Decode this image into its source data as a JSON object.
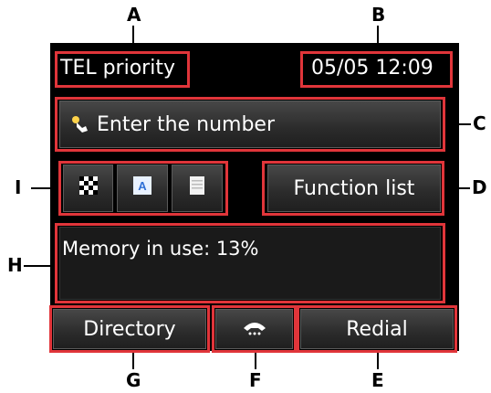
{
  "callouts": {
    "a": "A",
    "b": "B",
    "c": "C",
    "d": "D",
    "e": "E",
    "f": "F",
    "g": "G",
    "h": "H",
    "i": "I"
  },
  "status_bar": {
    "mode": "TEL priority",
    "datetime": "05/05 12:09"
  },
  "input": {
    "prompt": "Enter the number",
    "icon": "finger-tap-icon"
  },
  "quick_icons": [
    {
      "name": "checker-pattern-icon"
    },
    {
      "name": "text-a-icon"
    },
    {
      "name": "document-icon"
    }
  ],
  "function_list": {
    "label": "Function list"
  },
  "memory": {
    "text": "Memory in use: 13%",
    "percent": 13
  },
  "bottom_buttons": {
    "directory": "Directory",
    "hook_icon": "phone-hook-icon",
    "redial": "Redial"
  },
  "colors": {
    "highlight": "#e0353a",
    "screen": "#000000",
    "button": "#333333",
    "text": "#ffffff"
  }
}
